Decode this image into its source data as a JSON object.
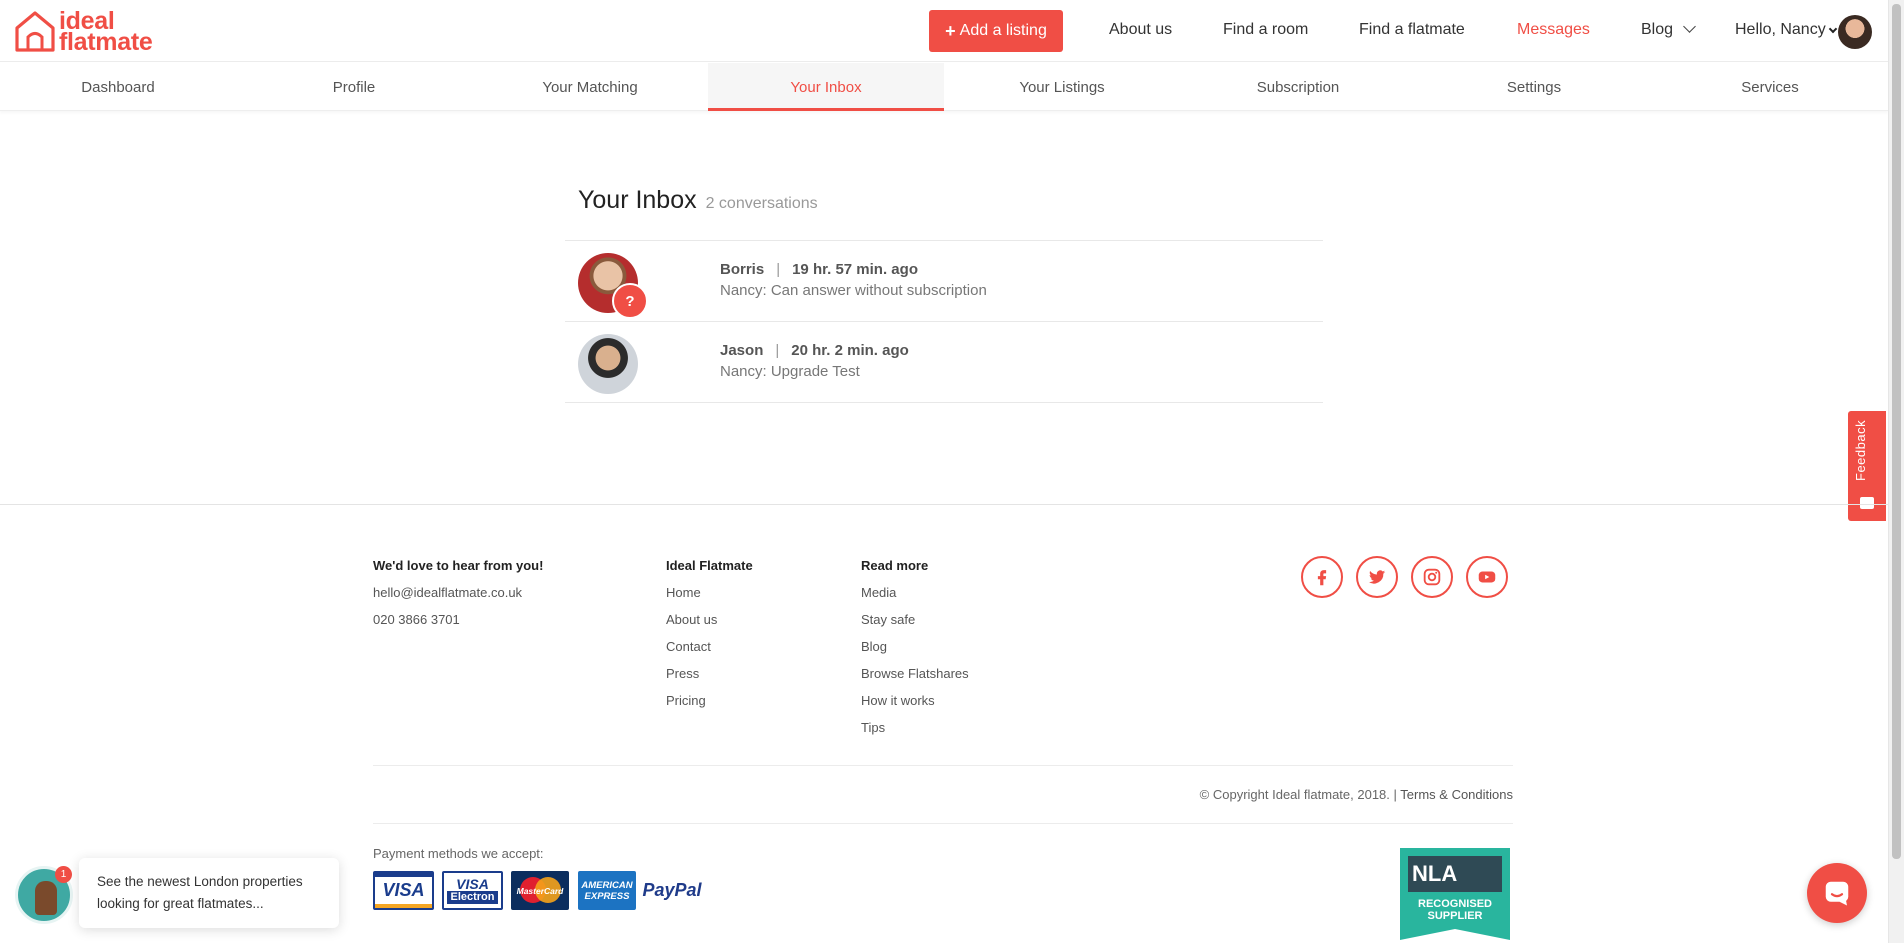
{
  "brand": {
    "line1": "ideal",
    "line2": "flatmate",
    "color": "#f04e45"
  },
  "header": {
    "add_listing": "Add a listing",
    "nav": {
      "about": "About us",
      "find_room": "Find a room",
      "find_flatmate": "Find a flatmate",
      "messages": "Messages",
      "blog": "Blog",
      "user": "Hello, Nancy"
    }
  },
  "tabs": {
    "dashboard": "Dashboard",
    "profile": "Profile",
    "matching": "Your Matching",
    "inbox": "Your Inbox",
    "listings": "Your Listings",
    "subscription": "Subscription",
    "settings": "Settings",
    "services": "Services"
  },
  "inbox": {
    "title": "Your Inbox",
    "count": "2 conversations",
    "conversations": [
      {
        "name": "Borris",
        "time": "19 hr. 57 min. ago",
        "message": "Nancy: Can answer without subscription",
        "badge": "?"
      },
      {
        "name": "Jason",
        "time": "20 hr. 2 min. ago",
        "message": "Nancy: Upgrade Test"
      }
    ]
  },
  "feedback": "Feedback",
  "footer": {
    "contact": {
      "heading": "We'd love to hear from you!",
      "email": "hello@idealflatmate.co.uk",
      "phone": "020 3866 3701"
    },
    "ideal": {
      "heading": "Ideal Flatmate",
      "links": [
        "Home",
        "About us",
        "Contact",
        "Press",
        "Pricing"
      ]
    },
    "readmore": {
      "heading": "Read more",
      "links": [
        "Media",
        "Stay safe",
        "Blog",
        "Browse Flatshares",
        "How it works",
        "Tips"
      ]
    },
    "social_icons": [
      "facebook-icon",
      "twitter-icon",
      "instagram-icon",
      "youtube-icon"
    ],
    "copyright": "© Copyright Ideal flatmate, 2018. |",
    "terms": "Terms & Conditions",
    "payment_label": "Payment methods we accept:",
    "payment": {
      "visa": "VISA",
      "visa_electron_1": "VISA",
      "visa_electron_2": "Electron",
      "mastercard": "MasterCard",
      "amex_1": "AMERICAN",
      "amex_2": "EXPRESS",
      "paypal": "PayPal"
    },
    "nla": {
      "logo": "NLA",
      "line1": "RECOGNISED",
      "line2": "SUPPLIER"
    }
  },
  "promo": {
    "badge": "1",
    "text": "See the newest London properties looking for great flatmates..."
  }
}
